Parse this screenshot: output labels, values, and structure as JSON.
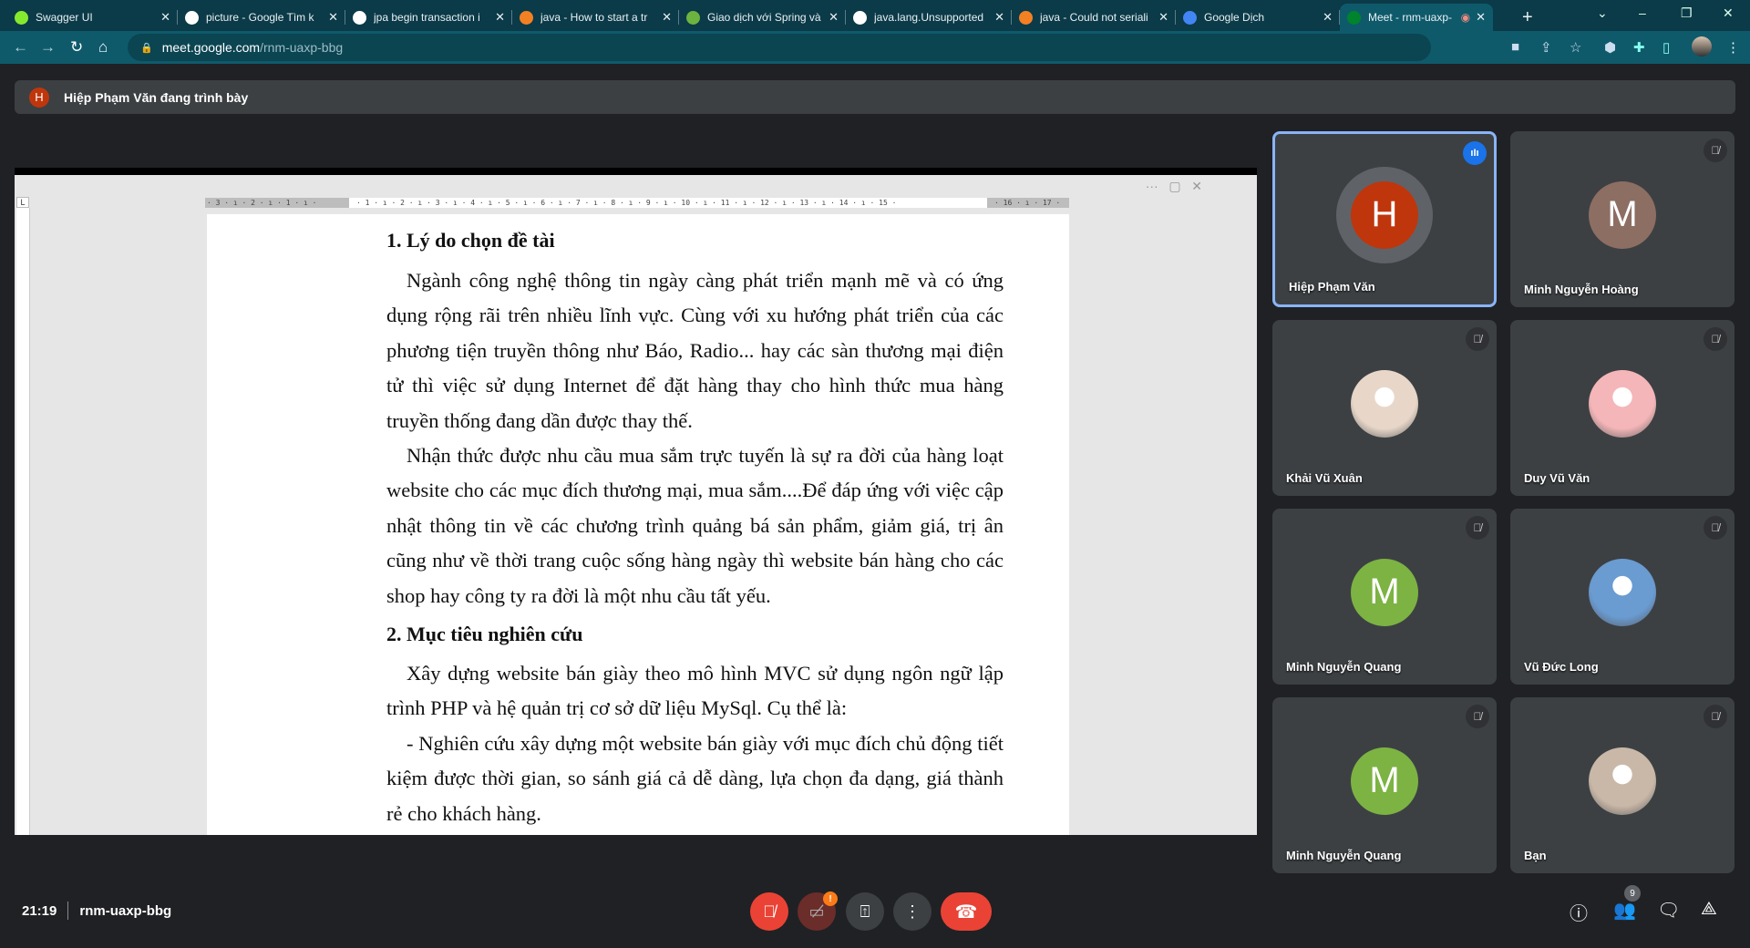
{
  "browser": {
    "tabs": [
      {
        "title": "Swagger UI",
        "favicon": "swagger-icon",
        "color": "#85ea2d"
      },
      {
        "title": "picture - Google Tìm k",
        "favicon": "google-icon",
        "color": "#ffffff"
      },
      {
        "title": "jpa begin transaction i",
        "favicon": "google-icon",
        "color": "#ffffff"
      },
      {
        "title": "java - How to start a tr",
        "favicon": "stackoverflow-icon",
        "color": "#f48024"
      },
      {
        "title": "Giao dịch với Spring và",
        "favicon": "leaf-icon",
        "color": "#6db33f"
      },
      {
        "title": "java.lang.Unsupported",
        "favicon": "google-icon",
        "color": "#ffffff"
      },
      {
        "title": "java - Could not seriali",
        "favicon": "stackoverflow-icon",
        "color": "#f48024"
      },
      {
        "title": "Google Dịch",
        "favicon": "translate-icon",
        "color": "#4285f4"
      },
      {
        "title": "Meet - rnm-uaxp-",
        "favicon": "meet-icon",
        "color": "#00832d",
        "active": true,
        "recording": true
      }
    ],
    "new_tab": "+",
    "url_host": "meet.google.com",
    "url_path": "/rnm-uaxp-bbg"
  },
  "banner": {
    "initial": "H",
    "text": "Hiệp Phạm Văn đang trình bày"
  },
  "document": {
    "ruler_left": "· 3 · ı · 2 · ı · 1 · ı ·",
    "ruler_main": "· 1 · ı · 2 · ı · 3 · ı · 4 · ı · 5 · ı · 6 · ı · 7 · ı · 8 · ı · 9 · ı · 10 · ı · 11 · ı · 12 · ı · 13 · ı · 14 · ı · 15 ·",
    "ruler_right": "· 16 · ı · 17 ·",
    "heading1": "1. Lý do chọn đề tài",
    "para1": "Ngành công nghệ thông tin ngày càng phát triển mạnh mẽ và có ứng dụng rộng rãi trên nhiều lĩnh vực. Cùng với xu hướng phát triển của các phương tiện truyền thông như Báo, Radio... hay các sàn thương mại điện tử thì việc sử dụng Internet để đặt hàng thay cho hình thức mua hàng truyền thống đang dần được thay thế.",
    "para2": "Nhận thức được nhu cầu mua sắm trực tuyến là sự ra đời của hàng loạt website cho các mục đích thương mại, mua sắm....Để đáp ứng với việc cập nhật thông tin về các chương trình quảng bá sản phẩm, giảm giá, trị ân cũng như về thời trang cuộc sống hàng ngày thì website bán hàng cho các shop hay công ty ra đời là một nhu cầu tất yếu.",
    "heading2": "2. Mục tiêu nghiên cứu",
    "para3": "Xây dựng website bán giày theo mô hình MVC sử dụng ngôn ngữ lập trình PHP và hệ quản trị cơ sở dữ liệu MySql. Cụ thể là:",
    "para4": "- Nghiên cứu xây dựng một website bán giày với mục đích chủ động tiết kiệm được thời gian, so sánh giá cả dễ dàng, lựa chọn đa dạng, giá thành rẻ cho khách hàng."
  },
  "participants": [
    {
      "name": "Hiệp Phạm Văn",
      "initial": "H",
      "color": "#bf360c",
      "speaking": true
    },
    {
      "name": "Minh Nguyễn Hoàng",
      "initial": "M",
      "color": "#8d6e63",
      "muted": true
    },
    {
      "name": "Khải Vũ Xuân",
      "photo": true,
      "color": "#e8d7c9",
      "muted": true
    },
    {
      "name": "Duy Vũ Văn",
      "photo": true,
      "color": "#f4b6b8",
      "muted": true
    },
    {
      "name": "Minh Nguyễn Quang",
      "initial": "M",
      "color": "#7cb342",
      "muted": true
    },
    {
      "name": "Vũ Đức Long",
      "photo": true,
      "color": "#6a9bd1",
      "muted": true
    },
    {
      "name": "Minh Nguyễn Quang",
      "initial": "M",
      "color": "#7cb342",
      "muted": true
    },
    {
      "name": "Bạn",
      "photo": true,
      "color": "#c9b8a8",
      "muted": true
    }
  ],
  "bottom": {
    "time": "21:19",
    "meeting_code": "rnm-uaxp-bbg",
    "camera_alert": "!",
    "people_count": "9"
  },
  "colors": {
    "danger": "#ea4335",
    "accent": "#8ab4f8",
    "alert": "#fa7b17"
  }
}
